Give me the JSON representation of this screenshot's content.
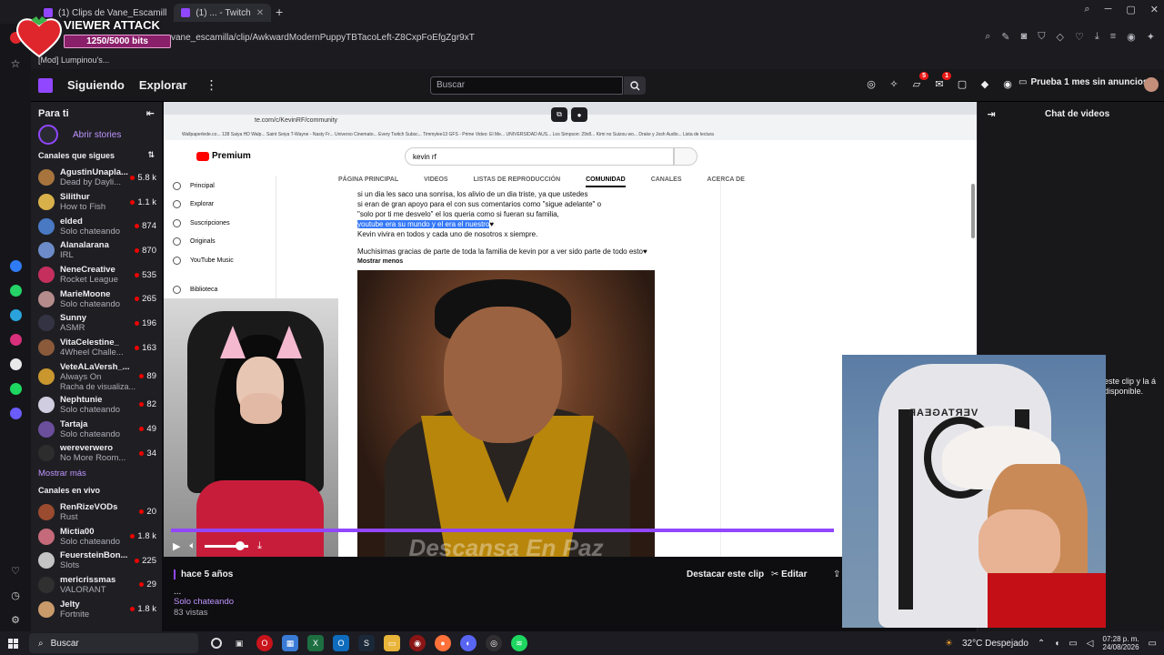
{
  "browser": {
    "tabs": [
      {
        "label": "(1) Clips de Vane_Escamill",
        "active": false
      },
      {
        "label": "(1) ... - Twitch",
        "active": true
      }
    ],
    "url": "vane_escamilla/clip/AwkwardModernPuppyTBTacoLeft-Z8CxpFoEfgZgr9xT",
    "bookmark": "[Mod] Lumpinou's..."
  },
  "overlay": {
    "title": "VIEWER ATTACK",
    "progress_text": "1250/5000 bits",
    "progress": 0.25
  },
  "nav": {
    "following": "Siguiendo",
    "explore": "Explorar",
    "search_placeholder": "Buscar",
    "notification_count_1": "5",
    "notification_count_2": "1",
    "prime_label": "Prueba 1 mes sin anuncios"
  },
  "sidebar": {
    "for_you": "Para ti",
    "stories": "Abrir stories",
    "followed_title": "Canales que sigues",
    "followed": [
      {
        "name": "AgustinUnapla...",
        "game": "Dead by Dayli...",
        "viewers": "5.8 k",
        "color": "#a8743d"
      },
      {
        "name": "Silithur",
        "game": "How to Fish",
        "viewers": "1.1 k",
        "color": "#d9b14a"
      },
      {
        "name": "elded",
        "game": "Solo chateando",
        "viewers": "874",
        "color": "#4a79c4"
      },
      {
        "name": "Alanalarana",
        "game": "IRL",
        "viewers": "870",
        "color": "#6d8bc8"
      },
      {
        "name": "NeneCreative",
        "game": "Rocket League",
        "viewers": "535",
        "color": "#c42f5e"
      },
      {
        "name": "MarieMoone",
        "game": "Solo chateando",
        "viewers": "265",
        "color": "#b58b8b"
      },
      {
        "name": "Sunny",
        "game": "ASMR",
        "viewers": "196",
        "color": "#333344"
      },
      {
        "name": "VitaCelestine_",
        "game": "4Wheel Challe...",
        "viewers": "163",
        "color": "#8a5a3a"
      },
      {
        "name": "VeteALaVersh_...",
        "game": "Always On",
        "viewers": "89",
        "color": "#c9972e"
      },
      {
        "name": "Nephtunie",
        "game": "Solo chateando",
        "viewers": "82",
        "color": "#d0cde0"
      },
      {
        "name": "Tartaja",
        "game": "Solo chateando",
        "viewers": "49",
        "color": "#6b4e9c"
      },
      {
        "name": "wereverwero",
        "game": "No More Room...",
        "viewers": "34",
        "color": "#2d2d2d"
      }
    ],
    "raid_note": "Racha de visualiza...",
    "show_more": "Mostrar más",
    "live_title": "Canales en vivo",
    "live": [
      {
        "name": "RenRizeVODs",
        "game": "Rust",
        "viewers": "20",
        "color": "#9b4b2f"
      },
      {
        "name": "Mictia00",
        "game": "Solo chateando",
        "viewers": "1.8 k",
        "color": "#c56a7a"
      },
      {
        "name": "FeuersteinBon...",
        "game": "Slots",
        "viewers": "225",
        "color": "#c4c4c4"
      },
      {
        "name": "mericrissmas",
        "game": "VALORANT",
        "viewers": "29",
        "color": "#303030"
      },
      {
        "name": "Jelty",
        "game": "Fortnite",
        "viewers": "1.8 k",
        "color": "#c99a6a"
      }
    ]
  },
  "video": {
    "yt_url": "te.com/c/KevinRF/community",
    "yt_bookmarks": "Wallpaperlede.co...   138 Saiya HD Walp...   Saint Seiya   T-Wayne - Nasty Fr...   Universo Cinemato...   Every Twitch Subsc...   Timmylee13 GFS -   Prime Video: El Me...   UNIVERSIDAD AUS...   Los Simpson: 29x8...   Kimi no Suizou wo...   Drake y Josh Audio...   Lista de lectura",
    "yt_logo": "Premium",
    "yt_search": "kevin rf",
    "yt_menu": [
      "Principal",
      "Explorar",
      "Suscripciones",
      "Originals",
      "YouTube Music",
      "Biblioteca"
    ],
    "yt_tabs": [
      "PÁGINA PRINCIPAL",
      "VIDEOS",
      "LISTAS DE REPRODUCCIÓN",
      "COMUNIDAD",
      "CANALES",
      "ACERCA DE"
    ],
    "post_lines": [
      "si un dia les saco una sonrisa, los alivio de un dia triste, ya que ustedes",
      "si eran de gran apoyo para el con sus comentarios como \"sigue adelante\" o",
      "\"solo por ti me desvelo\" el los queria como si fueran su familia,"
    ],
    "post_highlight": "youtube era su mundo y el era el nuestro",
    "post_line_after": "Kevin vivira en todos y cada uno de nosotros x siempre.",
    "post_thanks": "Muchisimas gracias de parte de toda la familia de kevin por a ver sido parte de todo esto",
    "show_less": "Mostrar menos",
    "caption": "Descansa En Paz",
    "progress": 0.83
  },
  "clip": {
    "age": "hace 5 años",
    "title": "...",
    "category": "Solo chateando",
    "views": "83 vistas",
    "feature_label": "Destacar este clip",
    "edit_label": "Editar"
  },
  "chat": {
    "title": "Chat de videos",
    "message": "este clip y la á disponible."
  },
  "cam2": {
    "chair_logo": "VERTAGEAR"
  },
  "taskbar": {
    "search": "Buscar",
    "weather": "32°C  Despejado",
    "time": "07:28 p. m.",
    "date": "24/08/2026"
  }
}
